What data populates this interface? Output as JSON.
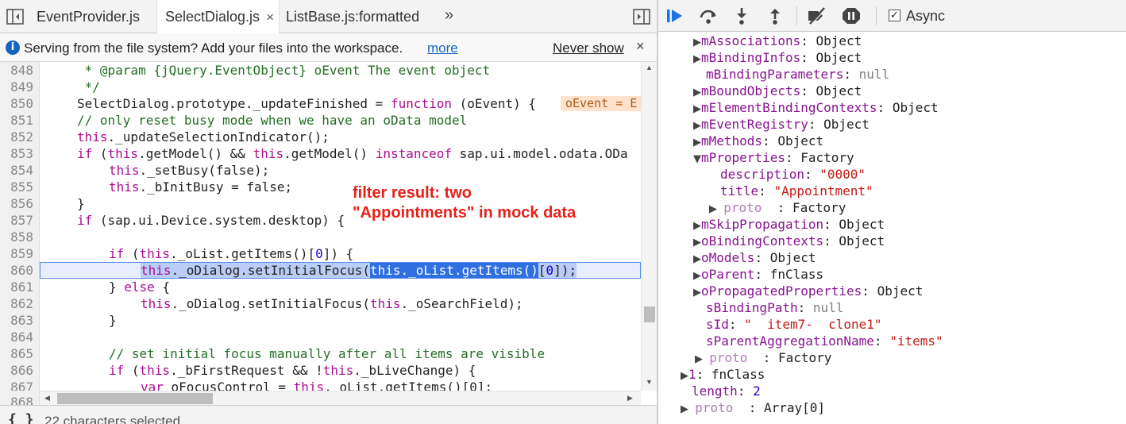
{
  "tabs": {
    "items": [
      {
        "label": "EventProvider.js"
      },
      {
        "label": "SelectDialog.js",
        "active": true
      },
      {
        "label": "ListBase.js:formatted"
      }
    ],
    "close_glyph": "×",
    "more_glyph": "»"
  },
  "infobar": {
    "message": "Serving from the file system? Add your files into the workspace.",
    "more_link": "more",
    "never_show": "Never show",
    "close_glyph": "×"
  },
  "editor": {
    "lines": [
      {
        "num": "848"
      },
      {
        "num": "849"
      },
      {
        "num": "850"
      },
      {
        "num": "851"
      },
      {
        "num": "852"
      },
      {
        "num": "853"
      },
      {
        "num": "854"
      },
      {
        "num": "855"
      },
      {
        "num": "856"
      },
      {
        "num": "857"
      },
      {
        "num": "858"
      },
      {
        "num": "859"
      },
      {
        "num": "860"
      },
      {
        "num": "861"
      },
      {
        "num": "862"
      },
      {
        "num": "863"
      },
      {
        "num": "864"
      },
      {
        "num": "865"
      },
      {
        "num": "866"
      },
      {
        "num": "867"
      },
      {
        "num": "868"
      }
    ],
    "code": {
      "l848": " * @param {jQuery.EventObject} oEvent The event object",
      "l849": " */",
      "l850_a": "SelectDialog.prototype._updateFinished = ",
      "l850_kw": "function",
      "l850_b": " (oEvent) {",
      "l850_inline": "oEvent = E",
      "l851": "// only reset busy mode when we have an oData model",
      "l852_kw": "this",
      "l852_b": "._updateSelectionIndicator();",
      "l853_kw1": "if",
      "l853_a": " (",
      "l853_kw2": "this",
      "l853_b": ".getModel() && ",
      "l853_kw3": "this",
      "l853_c": ".getModel() ",
      "l853_kw4": "instanceof",
      "l853_d": " sap.ui.model.odata.ODa",
      "l854_kw": "this",
      "l854_b": "._setBusy(false);",
      "l855_kw": "this",
      "l855_b": "._bInitBusy = false;",
      "l856": "}",
      "l857_kw": "if",
      "l857_b": " (sap.ui.Device.system.desktop) {",
      "l859_kw": "if",
      "l859_a": " (",
      "l859_kw2": "this",
      "l859_b": "._oList.getItems()[",
      "l859_n": "0",
      "l859_c": "]) {",
      "l860_kw": "this",
      "l860_a": "._oDialog.setInitialFocus(",
      "l860_sel": "this._oList.getItems()",
      "l860_b": "[",
      "l860_n": "0",
      "l860_c": "]);",
      "l861_a": "} ",
      "l861_kw": "else",
      "l861_b": " {",
      "l862_kw": "this",
      "l862_a": "._oDialog.setInitialFocus(",
      "l862_kw2": "this",
      "l862_b": "._oSearchField);",
      "l863": "}",
      "l865": "// set initial focus manually after all items are visible",
      "l866_kw": "if",
      "l866_a": " (",
      "l866_kw2": "this",
      "l866_b": "._bFirstRequest && !",
      "l866_kw3": "this",
      "l866_c": "._bLiveChange) {",
      "l867_kw": "var",
      "l867_a": " oFocusControl = ",
      "l867_kw2": "this",
      "l867_b": "._oList.getItems()[0];"
    }
  },
  "annotation": {
    "text": "filter result: two \"Appointments\" in mock data"
  },
  "status": {
    "braces": "{ }",
    "text": "22 characters selected"
  },
  "debugger": {
    "async_label": "Async",
    "async_checked": true,
    "tree": [
      {
        "key": "mAssociations",
        "sep": ": ",
        "val": "Object",
        "type": "obj"
      },
      {
        "key": "mBindingInfos",
        "sep": ": ",
        "val": "Object",
        "type": "obj"
      },
      {
        "key": "mBindingParameters",
        "sep": ": ",
        "val": "null",
        "type": "null"
      },
      {
        "key": "mBoundObjects",
        "sep": ": ",
        "val": "Object",
        "type": "obj"
      },
      {
        "key": "mElementBindingContexts",
        "sep": ": ",
        "val": "Object",
        "type": "obj"
      },
      {
        "key": "mEventRegistry",
        "sep": ": ",
        "val": "Object",
        "type": "obj"
      },
      {
        "key": "mMethods",
        "sep": ": ",
        "val": "Object",
        "type": "obj"
      },
      {
        "key": "mProperties",
        "sep": ": ",
        "val": "Factory",
        "type": "obj"
      },
      {
        "key": "description",
        "sep": ": ",
        "val": "\"0000\"",
        "type": "str"
      },
      {
        "key": "title",
        "sep": ": ",
        "val": "\"Appointment\"",
        "type": "str"
      },
      {
        "key": "proto",
        "sep": "  : ",
        "val": "Factory",
        "type": "obj"
      },
      {
        "key": "mSkipPropagation",
        "sep": ": ",
        "val": "Object",
        "type": "obj"
      },
      {
        "key": "oBindingContexts",
        "sep": ": ",
        "val": "Object",
        "type": "obj"
      },
      {
        "key": "oModels",
        "sep": ": ",
        "val": "Object",
        "type": "obj"
      },
      {
        "key": "oParent",
        "sep": ": ",
        "val": "fnClass",
        "type": "obj"
      },
      {
        "key": "oPropagatedProperties",
        "sep": ": ",
        "val": "Object",
        "type": "obj"
      },
      {
        "key": "sBindingPath",
        "sep": ": ",
        "val": "null",
        "type": "null"
      },
      {
        "key": "sId",
        "sep": ": ",
        "val": "\"  item7-  clone1\"",
        "type": "str"
      },
      {
        "key": "sParentAggregationName",
        "sep": ": ",
        "val": "\"items\"",
        "type": "str"
      },
      {
        "key": "proto",
        "sep": "  : ",
        "val": "Factory",
        "type": "obj"
      },
      {
        "key": "1",
        "sep": ": ",
        "val": "fnClass",
        "type": "obj"
      },
      {
        "key": "length",
        "sep": ": ",
        "val": "2",
        "type": "num"
      },
      {
        "key": "proto",
        "sep": "  : ",
        "val": "Array[0]",
        "type": "obj"
      }
    ]
  },
  "colors": {
    "keyword": "#aa0d91",
    "comment": "#236e25",
    "selection": "#2f6fe0",
    "annotation": "#e8201a",
    "link": "#1565c0"
  }
}
